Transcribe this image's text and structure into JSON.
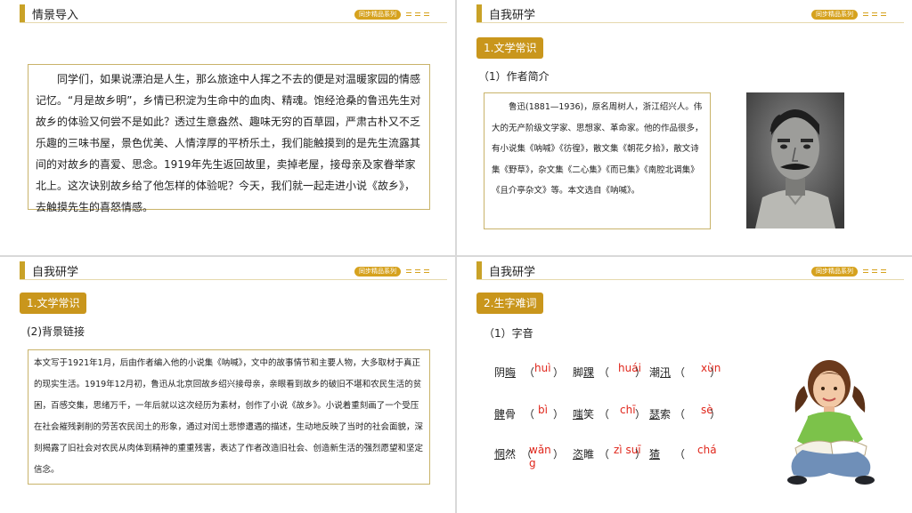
{
  "series_badge": "同步精品系列",
  "slide1": {
    "title": "情景导入",
    "paragraph": "同学们，如果说漂泊是人生，那么旅途中人挥之不去的便是对温暖家园的情感记忆。“月是故乡明”，乡情已积淀为生命中的血肉、精魂。饱经沧桑的鲁迅先生对故乡的体验又何尝不是如此？透过生意盎然、趣味无穷的百草园，严肃古朴又不乏乐趣的三味书屋，景色优美、人情淳厚的平桥乐土，我们能触摸到的是先生流露其间的对故乡的喜爱、思念。1919年先生返回故里，卖掉老屋，接母亲及家眷举家北上。这次诀别故乡给了他怎样的体验呢？今天，我们就一起走进小说《故乡》，去触摸先生的喜怒情感。"
  },
  "slide2": {
    "title": "自我研学",
    "tag": "1.文学常识",
    "subheading": "（1）作者简介",
    "paragraph": "鲁迅(1881—1936)，原名周树人，浙江绍兴人。伟大的无产阶级文学家、思想家、革命家。他的作品很多，有小说集《呐喊》《彷徨》，散文集《朝花夕拾》，散文诗集《野草》，杂文集《二心集》《而已集》《南腔北调集》《且介亭杂文》等。本文选自《呐喊》。"
  },
  "slide3": {
    "title": "自我研学",
    "tag": "1.文学常识",
    "subheading": "(2)背景链接",
    "paragraph": "本文写于1921年1月，后由作者编入他的小说集《呐喊》，文中的故事情节和主要人物，大多取材于真正的现实生活。1919年12月初，鲁迅从北京回故乡绍兴接母亲，亲眼看到故乡的破旧不堪和农民生活的贫困，百感交集，思绪万千，一年后就以这次经历为素材，创作了小说《故乡》。小说着重刻画了一个受压在社会摧残剥削的劳苦农民闰土的形象，通过对闰土悲惨遭遇的描述，生动地反映了当时的社会面貌，深刻揭露了旧社会对农民从肉体到精神的重重残害，表达了作者改造旧社会、创造新生活的强烈愿望和坚定信念。"
  },
  "slide4": {
    "title": "自我研学",
    "tag": "2.生字难词",
    "subheading": "（1）字音",
    "words": [
      {
        "pre": "阴",
        "u": "晦",
        "post": "",
        "pinyin": "huì"
      },
      {
        "pre": "脚",
        "u": "踝",
        "post": "",
        "pinyin": "huái"
      },
      {
        "pre": "潮",
        "u": "汛",
        "post": "",
        "pinyin": "xùn"
      },
      {
        "pre": "",
        "u": "髀",
        "post": "骨",
        "pinyin": "bì"
      },
      {
        "pre": "",
        "u": "嗤",
        "post": "笑",
        "pinyin": "chī"
      },
      {
        "pre": "",
        "u": "瑟",
        "post": "索",
        "pinyin": "sè"
      },
      {
        "pre": "",
        "u": "惘",
        "post": "然",
        "pinyin": "wǎng"
      },
      {
        "pre": "",
        "u": "恣",
        "post": "睢",
        "pinyin": "zì suī"
      },
      {
        "pre": "",
        "u": "猹",
        "post": "",
        "pinyin": "chá"
      }
    ]
  }
}
